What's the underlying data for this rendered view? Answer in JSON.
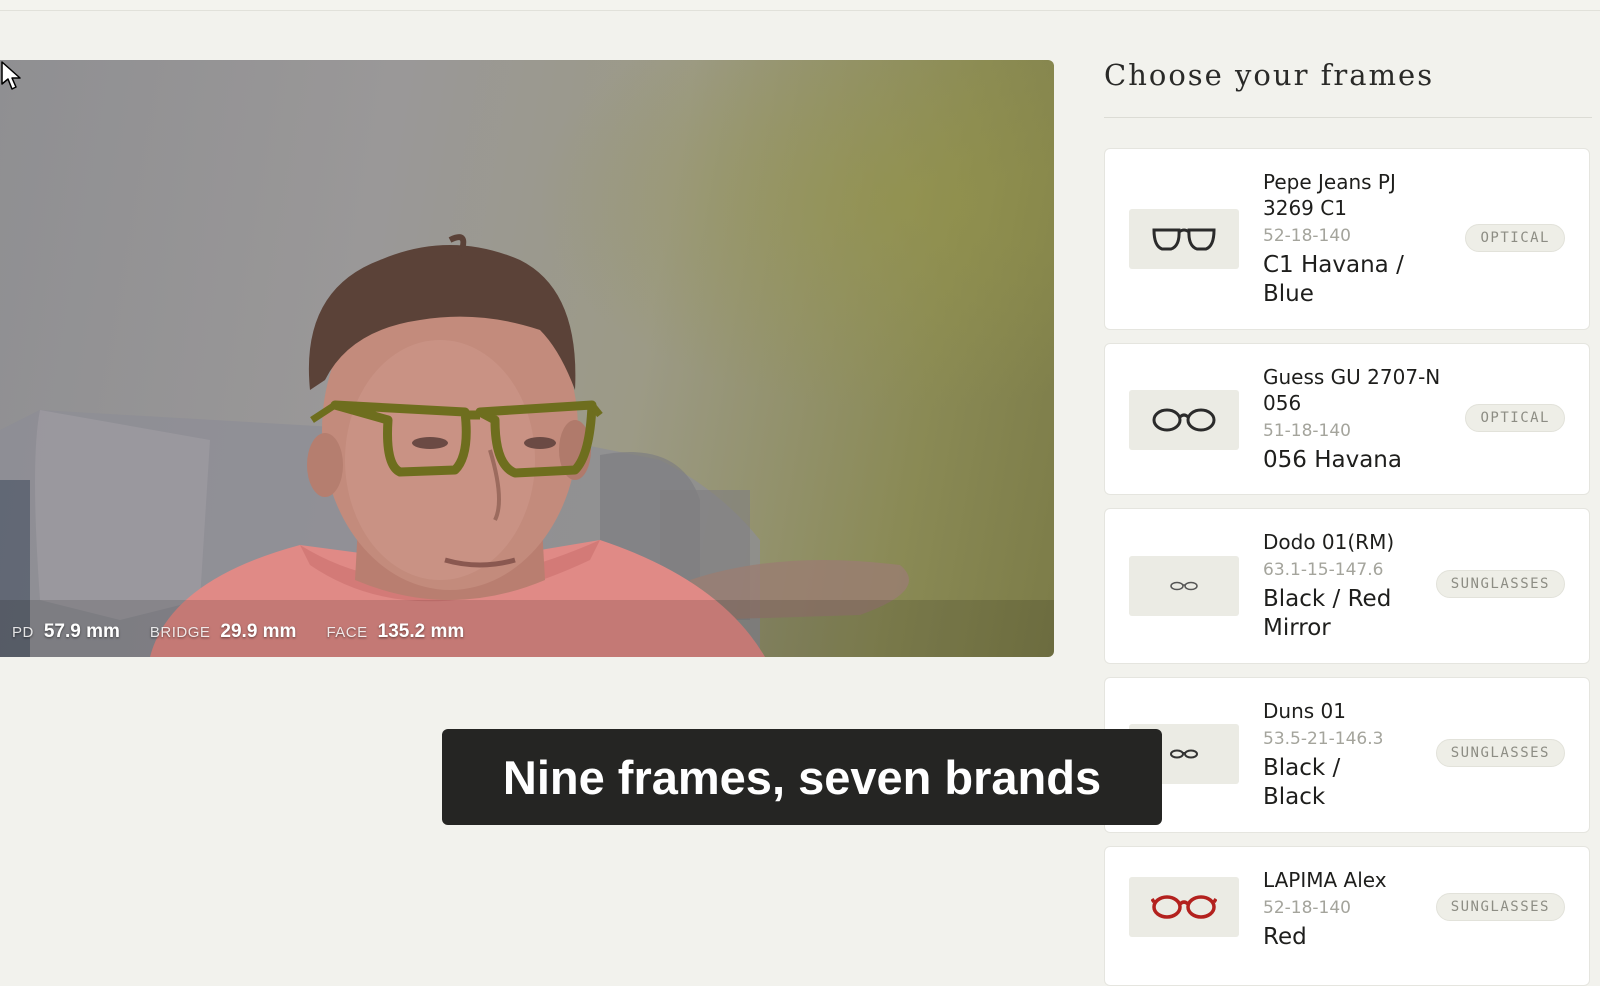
{
  "camera": {
    "measurements": [
      {
        "label": "PD",
        "value": "57.9 mm"
      },
      {
        "label": "BRIDGE",
        "value": "29.9 mm"
      },
      {
        "label": "FACE",
        "value": "135.2 mm"
      }
    ]
  },
  "panel": {
    "title": "Choose your frames",
    "frames": [
      {
        "name": "Pepe Jeans PJ 3269 C1",
        "size": "52-18-140",
        "color": "C1 Havana / Blue",
        "tag": "OPTICAL",
        "thumb_color": "#2b2b2b"
      },
      {
        "name": "Guess GU 2707-N 056",
        "size": "51-18-140",
        "color": "056 Havana",
        "tag": "OPTICAL",
        "thumb_color": "#2b2b2b"
      },
      {
        "name": "Dodo 01(RM)",
        "size": "63.1-15-147.6",
        "color": "Black / Red Mirror",
        "tag": "SUNGLASSES",
        "thumb_color": "#555555"
      },
      {
        "name": "Duns 01",
        "size": "53.5-21-146.3",
        "color": "Black / Black",
        "tag": "SUNGLASSES",
        "thumb_color": "#333333"
      },
      {
        "name": "LAPIMA Alex",
        "size": "52-18-140",
        "color": "Red",
        "tag": "SUNGLASSES",
        "thumb_color": "#b3211e"
      }
    ]
  },
  "caption": {
    "text": "Nine frames, seven brands"
  }
}
